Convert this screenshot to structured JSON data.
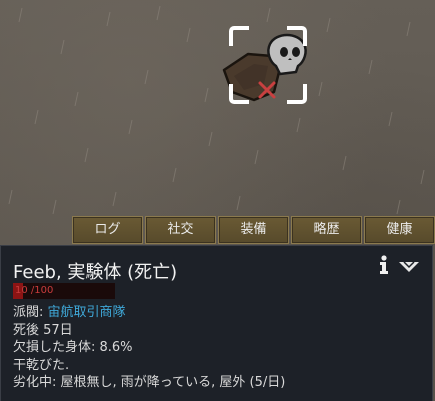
{
  "world": {
    "selection": {
      "label": "selected-pawn-corpse"
    }
  },
  "tabs": [
    {
      "id": "log",
      "label": "ログ"
    },
    {
      "id": "social",
      "label": "社交"
    },
    {
      "id": "gear",
      "label": "装備"
    },
    {
      "id": "bio",
      "label": "略歴"
    },
    {
      "id": "health",
      "label": "健康"
    }
  ],
  "inspect": {
    "title": "Feeb, 実験体 (死亡)",
    "health": {
      "text": "10 /100",
      "current": 10,
      "max": 100
    },
    "faction_label": "派閥: ",
    "faction_name": "宙航取引商隊",
    "lines": [
      "死後 57日",
      "欠損した身体: 8.6%",
      "干乾びた.",
      "劣化中: 屋根無し, 雨が降っている, 屋外 (5/日)"
    ]
  },
  "icons": {
    "info": "info-icon",
    "dropdown": "dropdown-chevron-icon",
    "corpse_mark": "cross-icon"
  },
  "colors": {
    "panel_bg": "#1d2128",
    "tab_bg": "#6a5a34",
    "health_fill": "#8c1414",
    "faction_link": "#3fa8d8",
    "selection_bracket": "#ffffff",
    "corpse_mark": "#c94040"
  }
}
